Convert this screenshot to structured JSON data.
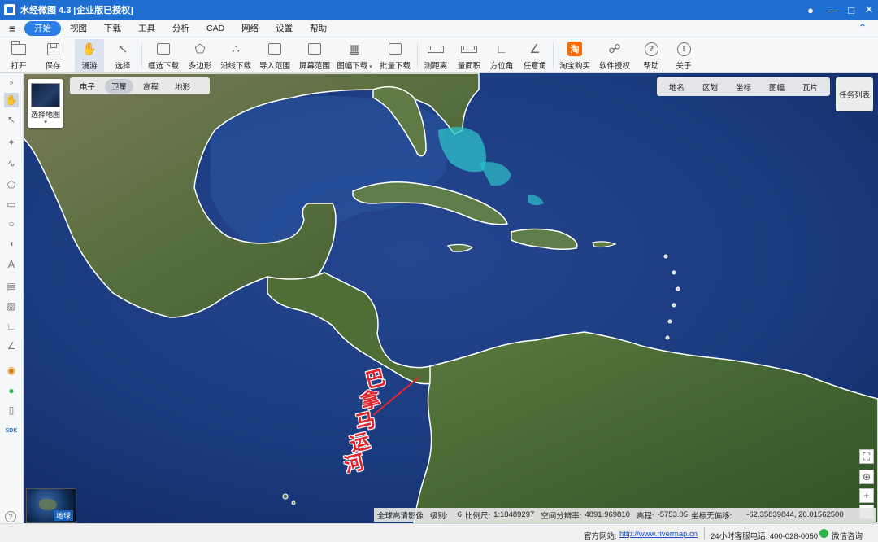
{
  "window": {
    "title": "水经微图 4.3 [企业版已授权]"
  },
  "menu": {
    "items": [
      "开始",
      "视图",
      "下载",
      "工具",
      "分析",
      "CAD",
      "网络",
      "设置",
      "帮助"
    ],
    "active": "开始"
  },
  "toolbar": {
    "open": "打开",
    "save": "保存",
    "roam": "漫游",
    "select": "选择",
    "frame_download": "框选下载",
    "polygon": "多边形",
    "line_download": "沿线下载",
    "import_range": "导入范围",
    "screen_range": "屏幕范围",
    "sheet_download": "图幅下载",
    "batch_download": "批量下载",
    "measure_distance": "测距离",
    "measure_area": "量面积",
    "azimuth": "方位角",
    "any_angle": "任意角",
    "taobao": "淘宝购买",
    "license": "软件授权",
    "help": "帮助",
    "about": "关于"
  },
  "map": {
    "layer_selector": "选择地图",
    "basemap_tabs": [
      "电子",
      "卫星",
      "高程",
      "地形"
    ],
    "basemap_active": "卫星",
    "overlay_tabs": [
      "地名",
      "区划",
      "坐标",
      "图幅",
      "瓦片"
    ],
    "task_list": "任务列表",
    "annotation": [
      "巴",
      "拿",
      "马",
      "运",
      "河"
    ],
    "globe_label": "地球",
    "annotation_color": "#e3262e"
  },
  "status": {
    "source": "全球高清影像",
    "level_label": "级别:",
    "level": "6",
    "scale_label": "比例尺:",
    "scale": "1:18489297",
    "resolution_label": "空间分辨率:",
    "resolution": "4891.969810",
    "elevation_label": "高程:",
    "elevation": "-5753.05",
    "coord_label": "坐标无偏移:",
    "coord": "-62.35839844, 26.01562500"
  },
  "footer": {
    "site_label": "官方网站:",
    "site_url": "http://www.rivermap.cn",
    "hotline": "24小时客服电话: 400-028-0050",
    "wechat": "微信咨询"
  },
  "sidebar": {
    "sdk_label": "SDK"
  },
  "colors": {
    "titlebar": "#1e6fd1",
    "menu_active": "#2b7de9",
    "ocean_deep": "#16357a",
    "land": "#4e6b35"
  }
}
